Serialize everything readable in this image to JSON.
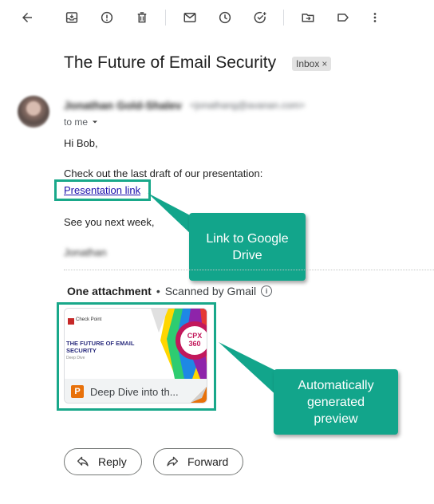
{
  "toolbar": {
    "icons": [
      "back-arrow-icon",
      "archive-icon",
      "report-spam-icon",
      "delete-icon",
      "mark-unread-icon",
      "snooze-icon",
      "add-task-icon",
      "move-to-icon",
      "label-icon",
      "more-vert-icon"
    ]
  },
  "message": {
    "subject": "The Future of Email Security",
    "label_chip": "Inbox",
    "label_chip_close": "×",
    "sender_name": "Jonathan Gold-Shalev",
    "sender_email": "<jonathang@avanan.com>",
    "recipient": "to me",
    "body": {
      "greeting": "Hi Bob,",
      "line1": "Check out the last draft of our presentation:",
      "link_text": "Presentation link",
      "closing": "See you next week,",
      "signature": "Jonathan"
    }
  },
  "attachments": {
    "header": "One attachment",
    "bullet": "•",
    "scan_status": "Scanned by Gmail",
    "info_glyph": "i",
    "file": {
      "name": "Deep Dive into th...",
      "type_letter": "P",
      "thumb_brand": "Check Point",
      "thumb_title_1": "THE FUTURE OF EMAIL",
      "thumb_title_2": "SECURITY",
      "thumb_subtitle": "Deep Dive",
      "thumb_badge_1": "CPX",
      "thumb_badge_2": "360"
    }
  },
  "callouts": {
    "link_callout": [
      "Link to Google",
      "Drive"
    ],
    "preview_callout": [
      "Automatically",
      "generated",
      "preview"
    ]
  },
  "actions": {
    "reply_label": "Reply",
    "forward_label": "Forward"
  },
  "colors": {
    "callout_bg": "#12a58b",
    "highlight_border": "#19a88a",
    "link": "#1a0dab"
  }
}
